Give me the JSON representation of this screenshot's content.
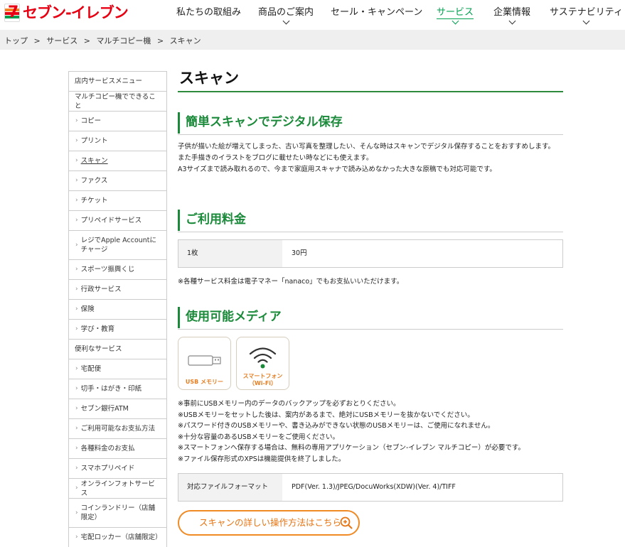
{
  "header": {
    "logo_text": "セブン-イレブン",
    "nav": [
      {
        "label": "私たちの取組み",
        "has_menu": false
      },
      {
        "label": "商品のご案内",
        "has_menu": true
      },
      {
        "label": "セール・キャンペーン",
        "has_menu": false
      },
      {
        "label": "サービス",
        "has_menu": true,
        "active": true
      },
      {
        "label": "企業情報",
        "has_menu": true
      },
      {
        "label": "サステナビリティ",
        "has_menu": true
      }
    ]
  },
  "breadcrumb": [
    "トップ",
    ">",
    "サービス",
    ">",
    "マルチコピー機",
    ">",
    "スキャン"
  ],
  "sidebar": {
    "items": [
      {
        "label": "店内サービスメニュー",
        "type": "head"
      },
      {
        "label": "マルチコピー機でできること",
        "type": "head"
      },
      {
        "label": "コピー",
        "type": "sub"
      },
      {
        "label": "プリント",
        "type": "sub"
      },
      {
        "label": "スキャン",
        "type": "sub",
        "current": true
      },
      {
        "label": "ファクス",
        "type": "sub"
      },
      {
        "label": "チケット",
        "type": "sub"
      },
      {
        "label": "プリペイドサービス",
        "type": "sub"
      },
      {
        "label": "レジでApple Accountにチャージ",
        "type": "sub"
      },
      {
        "label": "スポーツ振興くじ",
        "type": "sub"
      },
      {
        "label": "行政サービス",
        "type": "sub"
      },
      {
        "label": "保険",
        "type": "sub"
      },
      {
        "label": "学び・教育",
        "type": "sub"
      },
      {
        "label": "便利なサービス",
        "type": "head"
      },
      {
        "label": "宅配便",
        "type": "sub"
      },
      {
        "label": "切手・はがき・印紙",
        "type": "sub"
      },
      {
        "label": "セブン銀行ATM",
        "type": "sub"
      },
      {
        "label": "ご利用可能なお支払方法",
        "type": "sub"
      },
      {
        "label": "各種料金のお支払",
        "type": "sub"
      },
      {
        "label": "スマホプリペイド",
        "type": "sub"
      },
      {
        "label": "オンラインフォトサービス",
        "type": "sub"
      },
      {
        "label": "コインランドリー（店舗限定）",
        "type": "sub"
      },
      {
        "label": "宅配ロッカー（店舗限定）",
        "type": "sub"
      }
    ]
  },
  "main": {
    "title": "スキャン",
    "section1": {
      "title": "簡単スキャンでデジタル保存",
      "lines": [
        "子供が描いた絵が増えてしまった、古い写真を整理したい、そんな時はスキャンでデジタル保存することをおすすめします。",
        "また手描きのイラストをブログに載せたい時などにも使えます。",
        "A3サイズまで読み取れるので、今まで家庭用スキャナで読み込めなかった大きな原稿でも対応可能です。"
      ]
    },
    "section2": {
      "title": "ご利用料金",
      "price_key": "1枚",
      "price_value": "30円",
      "note": "※各種サービス料金は電子マネー「nanaco」でもお支払いいただけます。"
    },
    "section3": {
      "title": "使用可能メディア",
      "media": [
        {
          "label": "USB メモリー",
          "icon": "usb-memory-icon"
        },
        {
          "label_line1": "スマートフォン",
          "label_line2": "（Wi-Fi）",
          "icon": "wifi-icon"
        }
      ],
      "notes": [
        "※事前にUSBメモリー内のデータのバックアップを必ずおとりください。",
        "※USBメモリーをセットした後は、案内があるまで、絶対にUSBメモリーを抜かないでください。",
        "※パスワード付きのUSBメモリーや、書き込みができない状態のUSBメモリーは、ご使用になれません。",
        "※十分な容量のあるUSBメモリーをご使用ください。",
        "※スマートフォンへ保存する場合は、無料の専用アプリケーション（セブン-イレブン マルチコピー）が必要です。",
        "※ファイル保存形式のXPSは機能提供を終了しました。"
      ],
      "format_key": "対応ファイルフォーマット",
      "format_value": "PDF(Ver. 1.3)/JPEG/DocuWorks(XDW)(Ver. 4)/TIFF",
      "detail_button": "スキャンの詳しい操作方法はこちら"
    }
  },
  "colors": {
    "brand_red": "#e60012",
    "brand_orange": "#f58220",
    "brand_green": "#00a04e",
    "section_green": "#1a8a3a",
    "button_orange": "#f08a24"
  }
}
